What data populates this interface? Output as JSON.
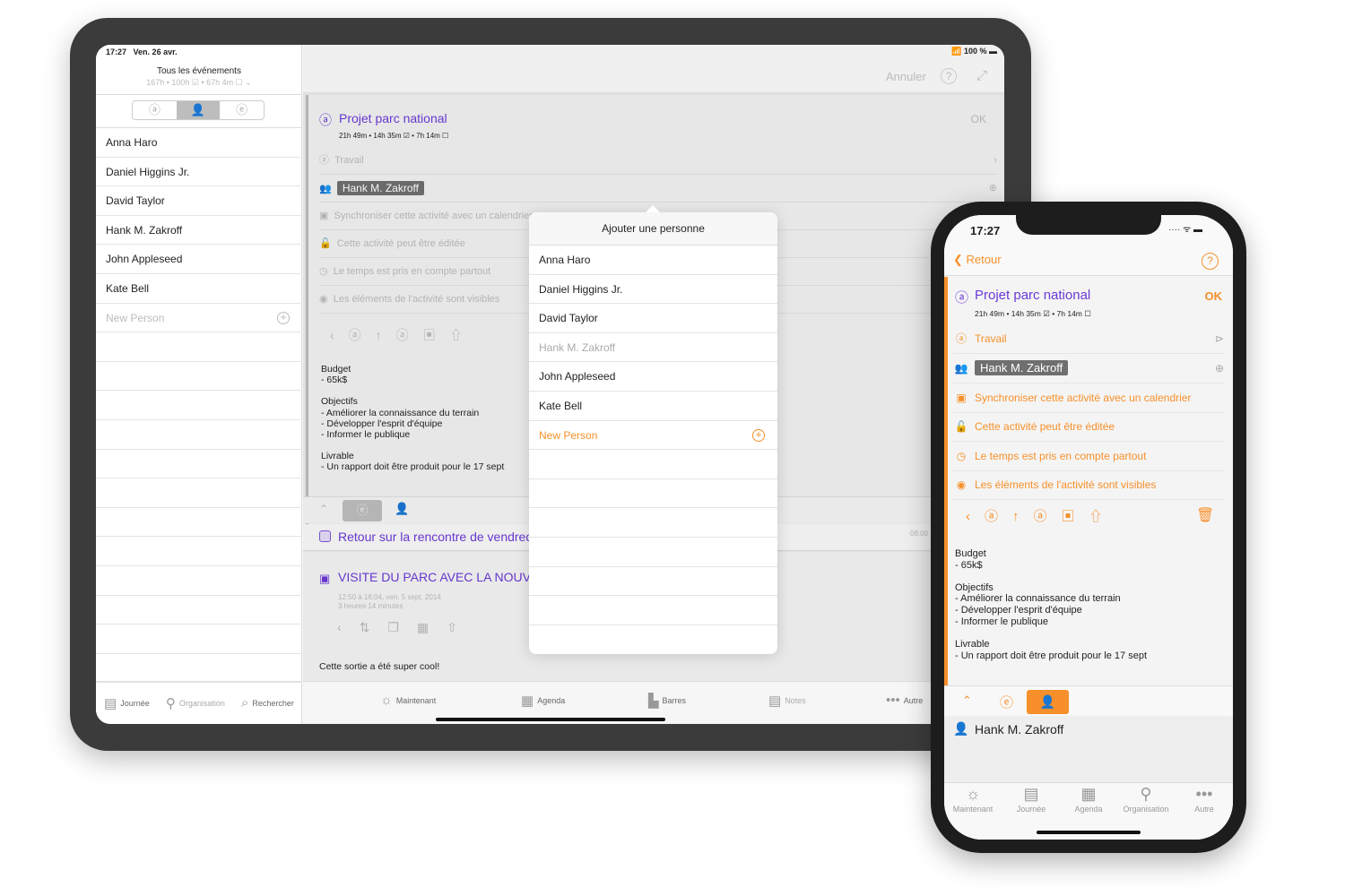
{
  "ipad": {
    "status": {
      "time": "17:27",
      "date": "Ven. 26 avr.",
      "battery": "100 %"
    },
    "sidebar": {
      "title": "Tous les événements",
      "subtitle": "167h • 100h ☑ • 67h 4m ☐ ⌄",
      "segments": [
        "ⓐ",
        "👤",
        "ⓔ"
      ],
      "people": [
        "Anna Haro",
        "Daniel Higgins Jr.",
        "David Taylor",
        "Hank M. Zakroff",
        "John Appleseed",
        "Kate Bell"
      ],
      "new_person_placeholder": "New Person",
      "tabs": [
        {
          "label": "Journée",
          "icon": "day-icon"
        },
        {
          "label": "Organisation",
          "icon": "org-icon"
        },
        {
          "label": "Rechercher",
          "icon": "search-icon"
        }
      ]
    },
    "main": {
      "cancel": "Annuler",
      "ok": "OK",
      "activity_title": "Projet parc national",
      "activity_stats": "21h 49m • 14h 35m ☑ • 7h 14m ☐",
      "category": "Travail",
      "person_chip": "Hank M. Zakroff",
      "options": [
        "Synchroniser cette activité avec un calendrier",
        "Cette activité peut être éditée",
        "Le temps est pris en compte partout",
        "Les éléments de l'activité sont visibles"
      ],
      "notes": [
        "Budget",
        "- 65k$",
        "",
        "Objectifs",
        "- Améliorer la connaissance du terrain",
        "- Développer l'esprit d'équipe",
        "- Informer le publique",
        "",
        "Livrable",
        "- Un rapport doit être produit pour le 17 sept"
      ],
      "event1_title": "Retour sur la rencontre de vendredi",
      "time_marker": "08:00",
      "event2_title": "VISITE DU PARC AVEC LA NOUVELLE",
      "event2_time": "12:50 à 16:04, ven. 5 sept. 2014",
      "event2_duration": "3 heures 14 minutes",
      "event2_note": "Cette sortie a été super cool!",
      "tabs": [
        {
          "label": "Maintenant",
          "icon": "sun-icon"
        },
        {
          "label": "Agenda",
          "icon": "calendar-icon"
        },
        {
          "label": "Barres",
          "icon": "bars-icon"
        },
        {
          "label": "Notes",
          "icon": "notes-icon"
        },
        {
          "label": "Autre",
          "icon": "more-icon"
        }
      ]
    },
    "popover": {
      "title": "Ajouter une personne",
      "people": [
        "Anna Haro",
        "Daniel Higgins Jr.",
        "David Taylor",
        "Hank M. Zakroff",
        "John Appleseed",
        "Kate Bell"
      ],
      "selected": "Hank M. Zakroff",
      "new_person": "New Person"
    }
  },
  "iphone": {
    "status": {
      "time": "17:27"
    },
    "back": "Retour",
    "ok": "OK",
    "activity_title": "Projet parc national",
    "activity_stats": "21h 49m • 14h 35m ☑ • 7h 14m ☐",
    "category": "Travail",
    "person_chip": "Hank M. Zakroff",
    "options": [
      "Synchroniser cette activité avec un calendrier",
      "Cette activité peut être éditée",
      "Le temps est pris en compte partout",
      "Les éléments de l'activité sont visibles"
    ],
    "notes": [
      "Budget",
      "- 65k$",
      "",
      "Objectifs",
      "- Améliorer la connaissance du terrain",
      "- Développer l'esprit d'équipe",
      "- Informer le publique",
      "",
      "Livrable",
      "- Un rapport doit être produit pour le 17 sept"
    ],
    "person_listed": "Hank M. Zakroff",
    "tabs": [
      {
        "label": "Maintenant",
        "icon": "sun-icon"
      },
      {
        "label": "Journée",
        "icon": "day-icon",
        "active": true
      },
      {
        "label": "Agenda",
        "icon": "calendar-icon"
      },
      {
        "label": "Organisation",
        "icon": "org-icon"
      },
      {
        "label": "Autre",
        "icon": "more-icon"
      }
    ]
  },
  "colors": {
    "accent_orange": "#f7902a",
    "title_purple": "#6b3ad6",
    "chip_gray": "#6f6f6f"
  }
}
